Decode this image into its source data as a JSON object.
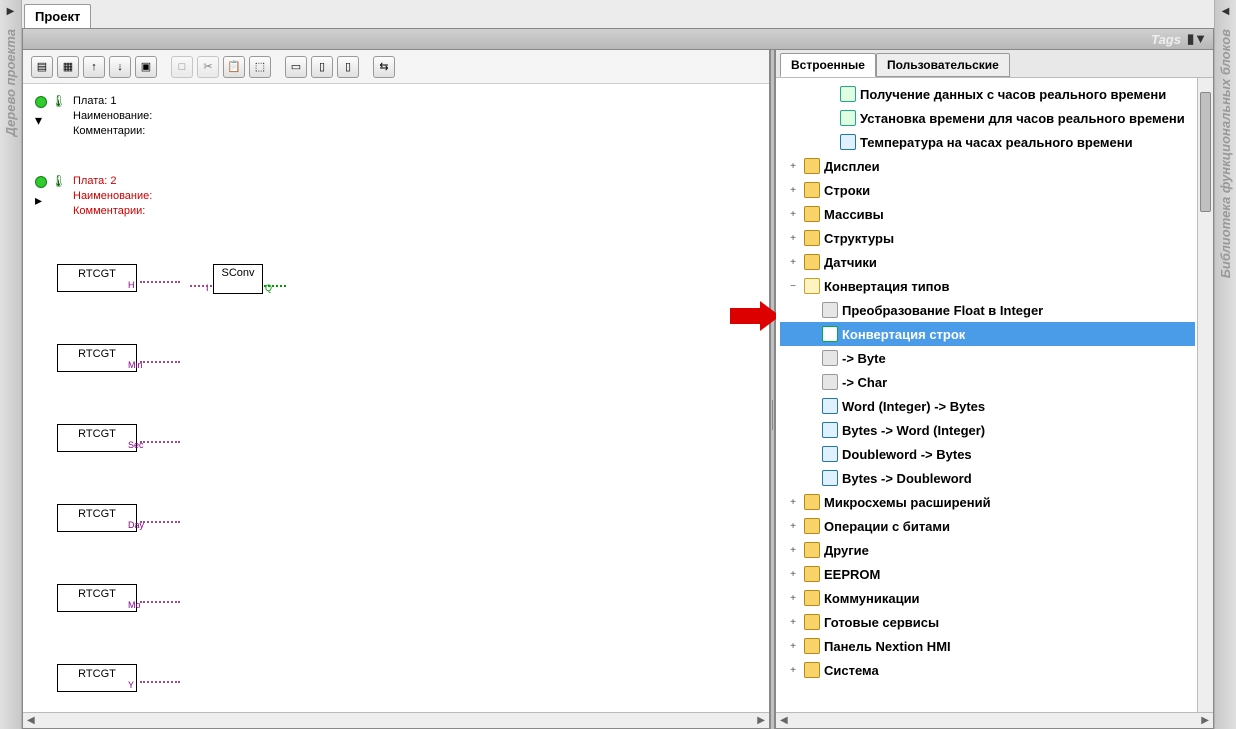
{
  "tabs": {
    "project": "Проект"
  },
  "tags_bar": {
    "label": "Tags"
  },
  "left_rail": {
    "label": "Дерево проекта"
  },
  "right_rail": {
    "label": "Библиотека функциональных блоков"
  },
  "canvas": {
    "board1": {
      "line1": "Плата: 1",
      "line2": "Наименование:",
      "line3": "Комментарии:"
    },
    "board2": {
      "line1": "Плата: 2",
      "line2": "Наименование:",
      "line3": "Комментарии:"
    },
    "sconv": {
      "title": "SConv",
      "pin_in": "I",
      "pin_out": "Q"
    },
    "blocks": [
      {
        "name": "RTCGT",
        "pin": "H"
      },
      {
        "name": "RTCGT",
        "pin": "Min"
      },
      {
        "name": "RTCGT",
        "pin": "Sec"
      },
      {
        "name": "RTCGT",
        "pin": "Day"
      },
      {
        "name": "RTCGT",
        "pin": "Mo"
      },
      {
        "name": "RTCGT",
        "pin": "Y"
      }
    ]
  },
  "library": {
    "tabs": {
      "builtin": "Встроенные",
      "user": "Пользовательские"
    },
    "nodes": [
      {
        "depth": 2,
        "toggle": "",
        "icon": "ic-clock",
        "label": "Получение данных с часов реального времени"
      },
      {
        "depth": 2,
        "toggle": "",
        "icon": "ic-clock",
        "label": "Установка времени для часов реального времени"
      },
      {
        "depth": 2,
        "toggle": "",
        "icon": "ic-temp",
        "label": "Температура на часах реального времени"
      },
      {
        "depth": 0,
        "toggle": "+",
        "icon": "ic-folder",
        "label": "Дисплеи"
      },
      {
        "depth": 0,
        "toggle": "+",
        "icon": "ic-folder",
        "label": "Строки"
      },
      {
        "depth": 0,
        "toggle": "+",
        "icon": "ic-folder",
        "label": "Массивы"
      },
      {
        "depth": 0,
        "toggle": "+",
        "icon": "ic-folder",
        "label": "Структуры"
      },
      {
        "depth": 0,
        "toggle": "+",
        "icon": "ic-folder",
        "label": "Датчики"
      },
      {
        "depth": 0,
        "toggle": "−",
        "icon": "ic-conv",
        "label": "Конвертация типов"
      },
      {
        "depth": 1,
        "toggle": "",
        "icon": "ic-generic",
        "label": "Преобразование Float в Integer"
      },
      {
        "depth": 1,
        "toggle": "",
        "icon": "ic-sel",
        "label": "Конвертация строк",
        "selected": true
      },
      {
        "depth": 1,
        "toggle": "",
        "icon": "ic-generic",
        "label": "-> Byte"
      },
      {
        "depth": 1,
        "toggle": "",
        "icon": "ic-generic",
        "label": "-> Char"
      },
      {
        "depth": 1,
        "toggle": "",
        "icon": "ic-temp",
        "label": "Word (Integer) -> Bytes"
      },
      {
        "depth": 1,
        "toggle": "",
        "icon": "ic-temp",
        "label": "Bytes -> Word (Integer)"
      },
      {
        "depth": 1,
        "toggle": "",
        "icon": "ic-temp",
        "label": "Doubleword -> Bytes"
      },
      {
        "depth": 1,
        "toggle": "",
        "icon": "ic-temp",
        "label": "Bytes -> Doubleword"
      },
      {
        "depth": 0,
        "toggle": "+",
        "icon": "ic-folder",
        "label": "Микросхемы расширений"
      },
      {
        "depth": 0,
        "toggle": "+",
        "icon": "ic-folder",
        "label": "Операции с битами"
      },
      {
        "depth": 0,
        "toggle": "+",
        "icon": "ic-folder",
        "label": "Другие"
      },
      {
        "depth": 0,
        "toggle": "+",
        "icon": "ic-folder",
        "label": "EEPROM"
      },
      {
        "depth": 0,
        "toggle": "+",
        "icon": "ic-folder",
        "label": "Коммуникации"
      },
      {
        "depth": 0,
        "toggle": "+",
        "icon": "ic-folder",
        "label": "Готовые сервисы"
      },
      {
        "depth": 0,
        "toggle": "+",
        "icon": "ic-folder",
        "label": "Панель Nextion HMI"
      },
      {
        "depth": 0,
        "toggle": "+",
        "icon": "ic-folder",
        "label": "Система"
      }
    ]
  },
  "toolbar_icons": [
    "▤",
    "▦",
    "↑",
    "↓",
    "▣",
    "□",
    "✂",
    "📋",
    "⬚",
    "▭",
    "▯",
    "▯",
    "⇆"
  ]
}
